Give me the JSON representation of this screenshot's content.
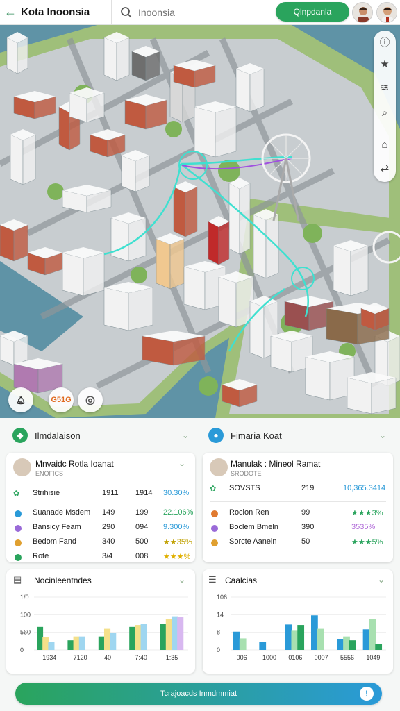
{
  "header": {
    "title": "Kota Inoonsia",
    "search_placeholder": "Inoonsia",
    "cta_label": "Qlnpdanla"
  },
  "colors": {
    "accent": "#2aa45d",
    "blue": "#2a9ad8",
    "water": "#5b8fa0",
    "grass": "#8fb26b"
  },
  "map": {
    "rail_icons": [
      "info-icon",
      "star-icon",
      "layers-icon",
      "search-icon",
      "pin-icon",
      "route-icon"
    ],
    "bottom_buttons": {
      "left_icon": "bell-icon",
      "badge_text": "G51G",
      "right_icon": "target-icon"
    }
  },
  "left_panel": {
    "title": "Ilmdalaison",
    "card": {
      "name": "Mnvaidc Rotla Ioanat",
      "sub": "ENOFICS",
      "summary": {
        "label": "Strihisie",
        "v1": "1911",
        "v2": "1914",
        "v3": "30.30%"
      },
      "rows": [
        {
          "label": "Suanade Msdem",
          "v1": "149",
          "v2": "199",
          "v3": "22.106%",
          "color": "#2a9ad8",
          "v3color": "#2aa45d"
        },
        {
          "label": "Bansicy Feam",
          "v1": "290",
          "v2": "094",
          "v3": "9.300%",
          "color": "#9a6ad8",
          "v3color": "#2a9ad8"
        },
        {
          "label": "Bedom Fand",
          "v1": "340",
          "v2": "500",
          "v3": "★★35%",
          "color": "#e0a030",
          "v3color": "#c0a000"
        },
        {
          "label": "Rote",
          "v1": "3/4",
          "v2": "008",
          "v3": "★★★%",
          "color": "#2aa45d",
          "v3color": "#e0b000"
        }
      ]
    }
  },
  "right_panel": {
    "title": "Fimaria Koat",
    "card": {
      "name": "Manulak : Mineol Ramat",
      "sub": "SRODOTE",
      "summary": {
        "label": "SOVSTS",
        "v1": "219",
        "v2": "10,365.3414"
      },
      "rows": [
        {
          "label": "Rocion Ren",
          "v1": "99",
          "v3": "★★★3%",
          "color": "#e07a30",
          "v3color": "#2aa45d"
        },
        {
          "label": "Boclem Bmeln",
          "v1": "390",
          "v3": "3535%",
          "color": "#9a6ad8",
          "v3color": "#b06ad8"
        },
        {
          "label": "Sorcte Aanein",
          "v1": "50",
          "v3": "★★★5%",
          "color": "#e0a030",
          "v3color": "#2aa45d"
        }
      ]
    }
  },
  "chart_left": {
    "title": "Nocinleentndes",
    "chart_data": {
      "type": "bar",
      "categories": [
        "1934",
        "7120",
        "40",
        "7:40",
        "1:35"
      ],
      "yticks": [
        "1/0",
        "100",
        "560",
        "0"
      ],
      "ylim": [
        0,
        110
      ],
      "series": [
        {
          "values": [
            48,
            20,
            28,
            48,
            55
          ],
          "color": "#2aa45d"
        },
        {
          "values": [
            26,
            28,
            44,
            52,
            65
          ],
          "color": "#f4e08a"
        },
        {
          "values": [
            16,
            28,
            36,
            54,
            70
          ],
          "color": "#9fd6f0"
        },
        {
          "values": [
            0,
            0,
            0,
            0,
            68
          ],
          "color": "#d8b8f0"
        }
      ]
    }
  },
  "chart_right": {
    "title": "Caalcias",
    "chart_data": {
      "type": "bar",
      "categories": [
        "006",
        "1000",
        "0106",
        "0007",
        "5556",
        "1049"
      ],
      "yticks": [
        "106",
        "14",
        "8",
        "0"
      ],
      "ylim": [
        0,
        110
      ],
      "series": [
        {
          "values": [
            38,
            17,
            53,
            72,
            22,
            43
          ],
          "color": "#2a9ad8"
        },
        {
          "values": [
            24,
            0,
            40,
            44,
            28,
            64
          ],
          "color": "#a8e0b0"
        },
        {
          "values": [
            0,
            0,
            52,
            0,
            20,
            12
          ],
          "color": "#2aa45d"
        }
      ]
    }
  },
  "footer": {
    "label": "Tcrajoacds Inmdmmiat",
    "icon": "info-icon"
  }
}
